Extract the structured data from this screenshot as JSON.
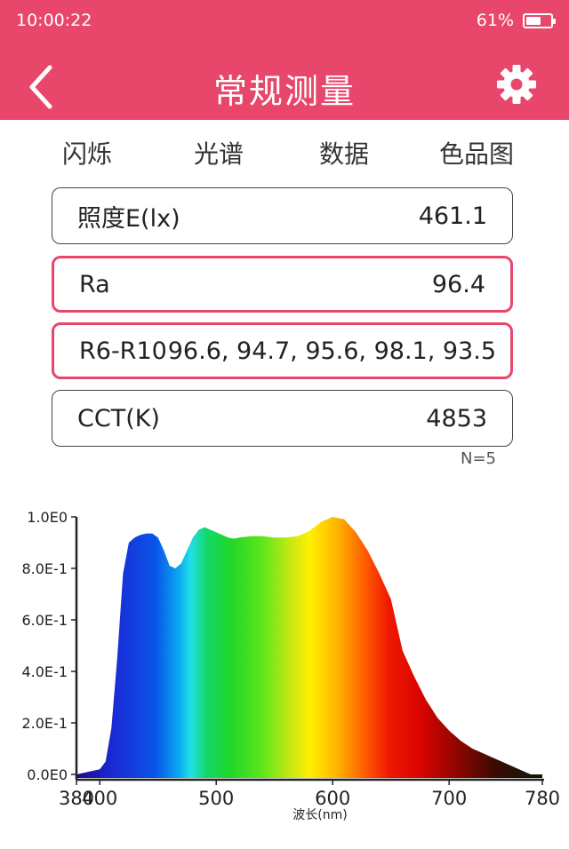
{
  "status": {
    "time": "10:00:22",
    "battery": "61%",
    "battery_level": 0.61
  },
  "header": {
    "title": "常规测量",
    "back_icon": "chevron-left-icon",
    "settings_icon": "gear-icon"
  },
  "tabs": [
    "闪烁",
    "光谱",
    "数据",
    "色品图"
  ],
  "readings": [
    {
      "label": "照度E(lx)",
      "value": "461.1"
    },
    {
      "label": "Ra",
      "value": "96.4"
    },
    {
      "label": "R6-R10",
      "value": "96.6, 94.7, 95.6, 98.1, 93.5"
    },
    {
      "label": "CCT(K)",
      "value": "4853"
    }
  ],
  "sample_count": "N=5",
  "colors": {
    "accent": "#e8476b"
  },
  "chart_data": {
    "type": "area",
    "xlabel": "波长(nm)",
    "ylabel": "",
    "xlim": [
      380,
      780
    ],
    "ylim": [
      0,
      1.0
    ],
    "x_ticks": [
      {
        "value": 380,
        "label": "380"
      },
      {
        "value": 400,
        "label": "400"
      },
      {
        "value": 500,
        "label": "500"
      },
      {
        "value": 600,
        "label": "600"
      },
      {
        "value": 700,
        "label": "700"
      },
      {
        "value": 780,
        "label": "780"
      }
    ],
    "y_ticks": [
      {
        "value": 0.0,
        "label": "0.0E0"
      },
      {
        "value": 0.2,
        "label": "2.0E-1"
      },
      {
        "value": 0.4,
        "label": "4.0E-1"
      },
      {
        "value": 0.6,
        "label": "6.0E-1"
      },
      {
        "value": 0.8,
        "label": "8.0E-1"
      },
      {
        "value": 1.0,
        "label": "1.0E0"
      }
    ],
    "x": [
      380,
      390,
      400,
      405,
      410,
      415,
      420,
      425,
      430,
      435,
      440,
      445,
      450,
      455,
      460,
      465,
      470,
      475,
      480,
      485,
      490,
      495,
      500,
      505,
      510,
      515,
      520,
      530,
      540,
      550,
      560,
      570,
      580,
      590,
      600,
      610,
      620,
      630,
      640,
      650,
      655,
      660,
      670,
      680,
      690,
      700,
      710,
      720,
      730,
      740,
      750,
      760,
      770,
      780
    ],
    "values": [
      0.0,
      0.01,
      0.02,
      0.05,
      0.18,
      0.45,
      0.78,
      0.9,
      0.92,
      0.93,
      0.935,
      0.935,
      0.92,
      0.87,
      0.81,
      0.8,
      0.82,
      0.87,
      0.92,
      0.95,
      0.96,
      0.95,
      0.94,
      0.93,
      0.92,
      0.915,
      0.92,
      0.925,
      0.925,
      0.92,
      0.92,
      0.925,
      0.945,
      0.98,
      1.0,
      0.99,
      0.94,
      0.87,
      0.78,
      0.68,
      0.58,
      0.48,
      0.38,
      0.29,
      0.22,
      0.17,
      0.13,
      0.1,
      0.08,
      0.06,
      0.04,
      0.02,
      0.0,
      0.0
    ]
  }
}
